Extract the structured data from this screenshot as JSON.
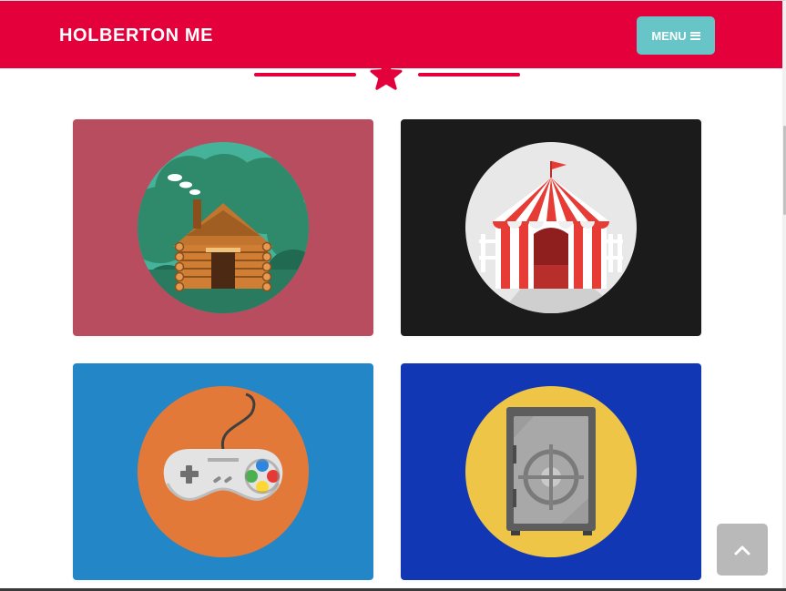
{
  "navbar": {
    "brand": "HOLBERTON ME",
    "menu_label": "MENU",
    "menu_icon": "bars-icon",
    "background_color": "#E3003B",
    "menu_button_color": "#67C4C7"
  },
  "divider": {
    "icon": "star-icon",
    "color": "#E3003B"
  },
  "portfolio": {
    "items": [
      {
        "icon": "cabin-icon",
        "background_color": "#B94D60",
        "circle_color": "#45B39A"
      },
      {
        "icon": "circus-tent-icon",
        "background_color": "#1B1B1B",
        "circle_color": "#E8E8E8"
      },
      {
        "icon": "game-controller-icon",
        "background_color": "#2386C6",
        "circle_color": "#E27938"
      },
      {
        "icon": "safe-icon",
        "background_color": "#1237B4",
        "circle_color": "#EFC547"
      }
    ]
  },
  "back_to_top": {
    "icon": "chevron-up-icon",
    "color": "#B9B9B9"
  }
}
